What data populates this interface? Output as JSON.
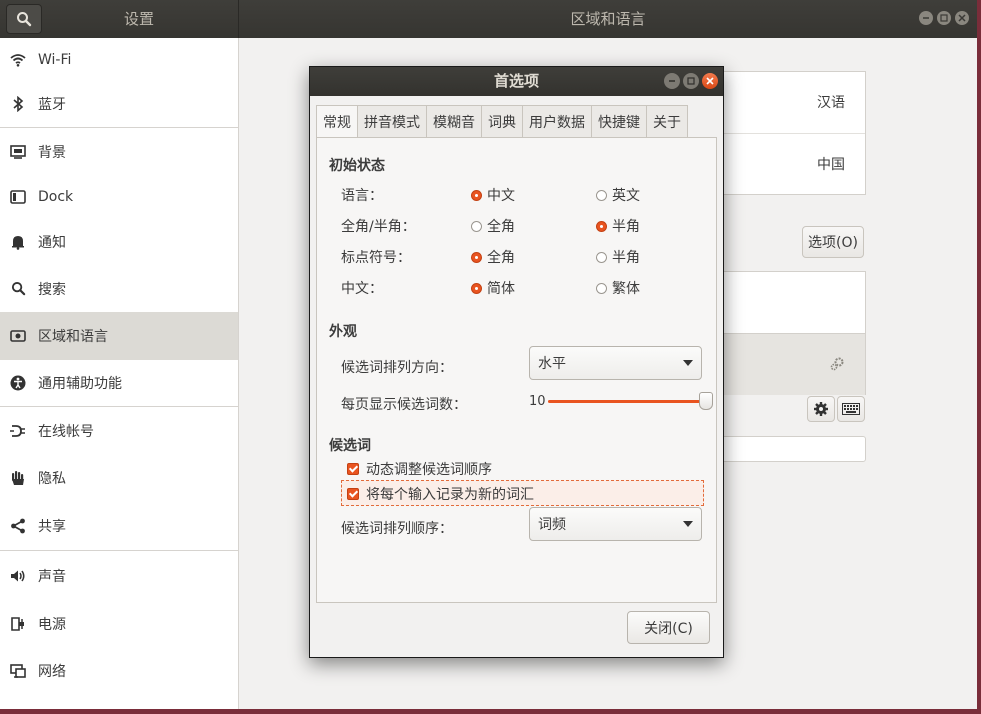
{
  "window": {
    "left_title": "设置",
    "right_title": "区域和语言"
  },
  "sidebar": {
    "items": [
      {
        "label": "Wi-Fi",
        "icon": "wifi-icon"
      },
      {
        "label": "蓝牙",
        "icon": "bluetooth-icon"
      },
      {
        "label": "背景",
        "icon": "background-icon"
      },
      {
        "label": "Dock",
        "icon": "dock-icon"
      },
      {
        "label": "通知",
        "icon": "bell-icon"
      },
      {
        "label": "搜索",
        "icon": "search-icon"
      },
      {
        "label": "区域和语言",
        "icon": "region-icon"
      },
      {
        "label": "通用辅助功能",
        "icon": "accessibility-icon"
      },
      {
        "label": "在线帐号",
        "icon": "online-accounts-icon"
      },
      {
        "label": "隐私",
        "icon": "hand-icon"
      },
      {
        "label": "共享",
        "icon": "share-icon"
      },
      {
        "label": "声音",
        "icon": "speaker-icon"
      },
      {
        "label": "电源",
        "icon": "power-icon"
      },
      {
        "label": "网络",
        "icon": "network-icon"
      }
    ],
    "selected": "区域和语言"
  },
  "region": {
    "language_value": "汉语",
    "formats_value": "中国",
    "options_button": "选项(O)"
  },
  "dialog": {
    "title": "首选项",
    "tabs": [
      "常规",
      "拼音模式",
      "模糊音",
      "词典",
      "用户数据",
      "快捷键",
      "关于"
    ],
    "active_tab": "常规",
    "initial_state": {
      "heading": "初始状态",
      "rows": [
        {
          "label": "语言：",
          "opt1": "中文",
          "opt2": "英文",
          "selected": 1
        },
        {
          "label": "全角/半角：",
          "opt1": "全角",
          "opt2": "半角",
          "selected": 2
        },
        {
          "label": "标点符号：",
          "opt1": "全角",
          "opt2": "半角",
          "selected": 1
        },
        {
          "label": "中文：",
          "opt1": "简体",
          "opt2": "繁体",
          "selected": 1
        }
      ]
    },
    "appearance": {
      "heading": "外观",
      "orientation_label": "候选词排列方向：",
      "orientation_value": "水平",
      "page_size_label": "每页显示候选词数：",
      "page_size_value": "10"
    },
    "candidates": {
      "heading": "候选词",
      "dynamic_adjust": "动态调整候选词顺序",
      "record_new": "将每个输入记录为新的词汇",
      "order_label": "候选词排列顺序：",
      "order_value": "词频"
    },
    "close_button": "关闭(C)"
  },
  "colors": {
    "accent": "#e95420",
    "titlebar": "#3b3a36",
    "desktop": "#7a2d3a"
  }
}
